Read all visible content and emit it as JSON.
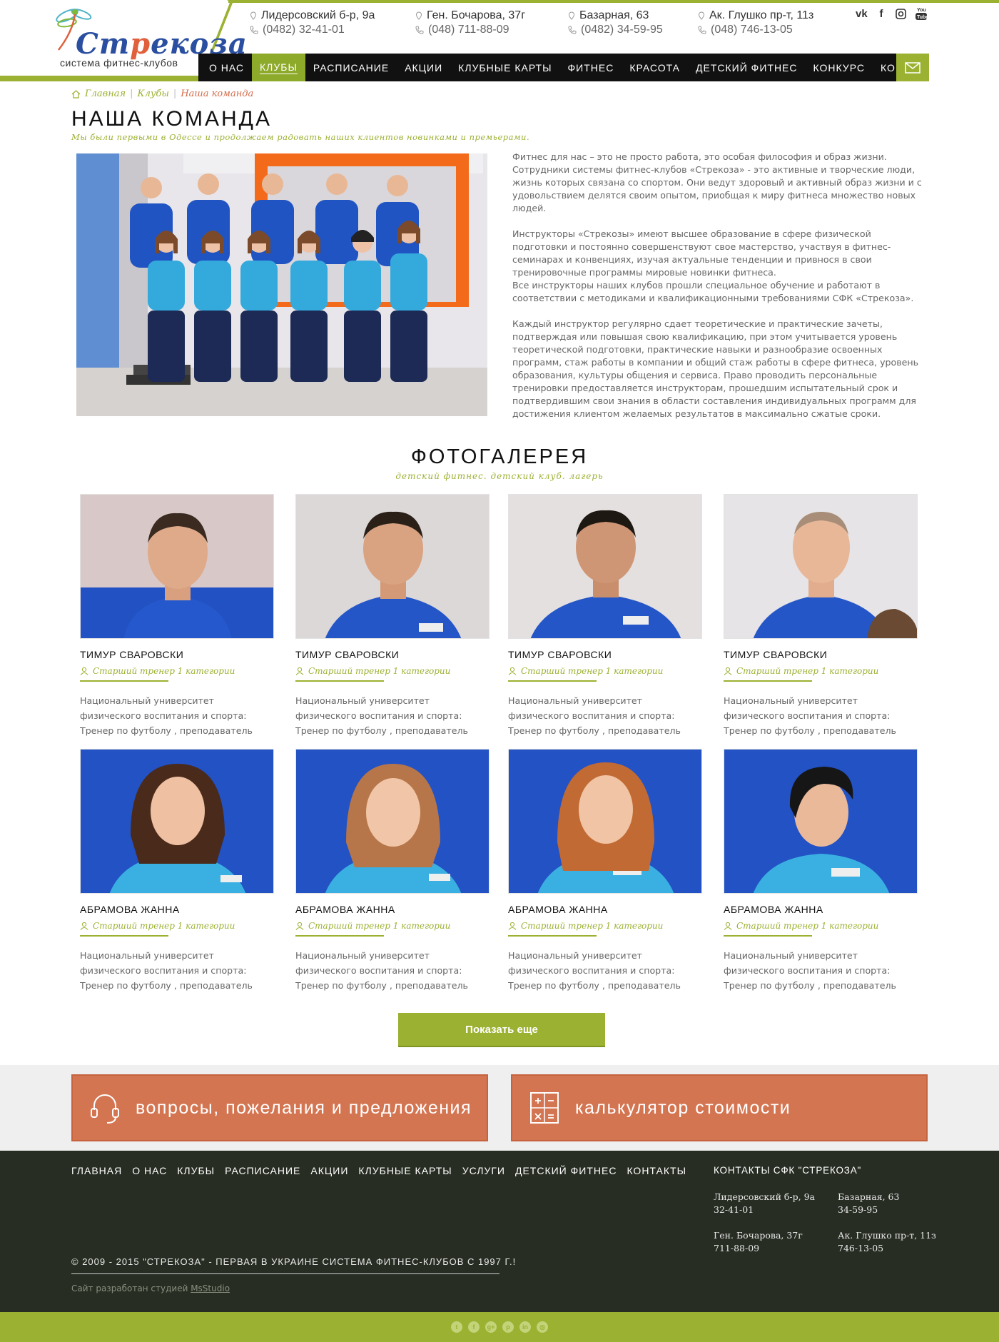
{
  "logo": {
    "word_pre": "Ст",
    "word_accent": "р",
    "word_post": "екоза",
    "sub": "система фитнес-клубов"
  },
  "addresses": [
    {
      "address": "Лидерсовский б-р, 9а",
      "phone": "(0482) 32-41-01"
    },
    {
      "address": "Ген. Бочарова, 37г",
      "phone": "(048) 711-88-09"
    },
    {
      "address": "Базарная, 63",
      "phone": "(0482) 34-59-95"
    },
    {
      "address": "Ак. Глушко пр-т, 11з",
      "phone": "(048) 746-13-05"
    }
  ],
  "socials": [
    "vk-icon",
    "facebook-icon",
    "instagram-icon",
    "youtube-icon"
  ],
  "nav": {
    "items": [
      "О НАС",
      "КЛУБЫ",
      "РАСПИСАНИЕ",
      "АКЦИИ",
      "КЛУБНЫЕ КАРТЫ",
      "ФИТНЕС",
      "КРАСОТА",
      "ДЕТСКИЙ ФИТНЕС",
      "КОНКУРС",
      "КОНТАКТЫ"
    ],
    "active": "КЛУБЫ"
  },
  "breadcrumb": {
    "home": "Главная",
    "clubs": "Клубы",
    "current": "Наша команда"
  },
  "page": {
    "title": "НАША КОМАНДА",
    "subtitle": "Мы были первыми в Одессе и продолжаем радовать наших клиентов новинками и премьерами."
  },
  "intro": {
    "p1": "Фитнес для нас – это не просто работа, это особая философия и образ жизни. Сотрудники системы фитнес-клубов «Стрекоза» - это активные и творческие люди, жизнь которых связана со спортом. Они ведут здоровый и активный образ жизни и с удовольствием делятся своим опытом, приобщая к миру фитнеса множество новых людей.",
    "p2a": "Инструкторы «Стрекозы» имеют высшее образование в сфере физической подготовки и постоянно совершенствуют свое мастерство, участвуя в фитнес-семинарах и конвенциях, изучая актуальные тенденции и привнося в свои тренировочные программы мировые новинки фитнеса.",
    "p2b": "Все инструкторы наших клубов прошли специальное обучение и работают в соответствии с методиками и квалификационными требованиями СФК «Стрекоза».",
    "p3": "Каждый инструктор регулярно сдает теоретические и практические зачеты, подтверждая или повышая свою квалификацию, при этом учитывается уровень теоретической подготовки, практические навыки и разнообразие освоенных программ, стаж работы в компании и общий стаж работы в сфере фитнеса, уровень образования, культуры общения и сервиса. Право проводить персональные тренировки предоставляется инструкторам, прошедшим испытательный срок и подтвердившим свои знания в области составления индивидуальных программ для достижения клиентом желаемых результатов в максимально сжатые сроки."
  },
  "gallery": {
    "title": "ФОТОГАЛЕРЕЯ",
    "subtitle": "детский фитнес. детский клуб. лагерь",
    "cards": [
      {
        "name": "ТИМУР СВАРОВСКИ",
        "role": "Старший тренер 1 категории",
        "desc": "Национальный университет физического воспитания и спорта: Тренер  по футболу , преподаватель физического воспитания"
      },
      {
        "name": "ТИМУР СВАРОВСКИ",
        "role": "Старший тренер 1 категории",
        "desc": "Национальный университет физического воспитания и спорта: Тренер  по футболу , преподаватель физического воспитания"
      },
      {
        "name": "ТИМУР СВАРОВСКИ",
        "role": "Старший тренер 1 категории",
        "desc": "Национальный университет физического воспитания и спорта: Тренер  по футболу , преподаватель физического воспитания"
      },
      {
        "name": "ТИМУР СВАРОВСКИ",
        "role": "Старший тренер 1 категории",
        "desc": "Национальный университет физического воспитания и спорта: Тренер  по футболу , преподаватель физического воспитания"
      },
      {
        "name": "АБРАМОВА ЖАННА",
        "role": "Старший тренер 1 категории",
        "desc": "Национальный университет физического воспитания и спорта: Тренер  по футболу , преподаватель физического воспитания"
      },
      {
        "name": "АБРАМОВА ЖАННА",
        "role": "Старший тренер 1 категории",
        "desc": "Национальный университет физического воспитания и спорта: Тренер  по футболу , преподаватель физического воспитания"
      },
      {
        "name": "АБРАМОВА ЖАННА",
        "role": "Старший тренер 1 категории",
        "desc": "Национальный университет физического воспитания и спорта: Тренер  по футболу , преподаватель физического воспитания"
      },
      {
        "name": "АБРАМОВА ЖАННА",
        "role": "Старший тренер 1 категории",
        "desc": "Национальный университет физического воспитания и спорта: Тренер  по футболу , преподаватель физического воспитания"
      }
    ],
    "more_button": "Показать еще"
  },
  "actions": {
    "feedback": "вопросы, пожелания и предложения",
    "calculator": "калькулятор стоимости"
  },
  "footer": {
    "nav": [
      "ГЛАВНАЯ",
      "О НАС",
      "КЛУБЫ",
      "РАСПИСАНИЕ",
      "АКЦИИ",
      "КЛУБНЫЕ КАРТЫ",
      "УСЛУГИ",
      "ДЕТСКИЙ ФИТНЕС",
      "КОНТАКТЫ"
    ],
    "contacts_title": "КОНТАКТЫ  СФК \"СТРЕКОЗА\"",
    "contacts": [
      {
        "address": "Лидерсовский б-р, 9а",
        "phone": "32-41-01"
      },
      {
        "address": "Базарная, 63",
        "phone": "34-59-95"
      },
      {
        "address": "Ген. Бочарова, 37г",
        "phone": "711-88-09"
      },
      {
        "address": "Ак. Глушко пр-т, 11з",
        "phone": "746-13-05"
      }
    ],
    "copyright": "© 2009 - 2015 \"СТРЕКОЗА\" - ПЕРВАЯ В УКРАИНЕ СИСТЕМА ФИТНЕС-КЛУБОВ С 1997 Г.!",
    "dev_prefix": "Сайт разработан студией",
    "dev_link": "MsStudio"
  },
  "bottom_socials": [
    "twitter-icon",
    "facebook-icon",
    "google-plus-icon",
    "pinterest-icon",
    "linkedin-icon",
    "dribbble-icon"
  ],
  "colors": {
    "brand_green": "#9bb131",
    "accent_orange": "#d47552",
    "footer_bg": "#272d22",
    "logo_blue": "#2a4ea0"
  }
}
